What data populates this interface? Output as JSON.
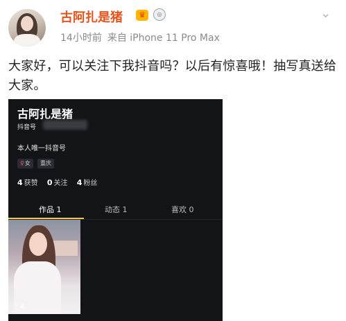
{
  "post": {
    "username": "古阿扎是猪",
    "vip_badge_glyph": "♛",
    "level_badge_glyph": "◎",
    "more_glyph": "⌄",
    "time": "14小时前",
    "source": "来自 iPhone 11 Pro Max",
    "text": "大家好，可以关注下我抖音吗？以后有惊喜哦！抽写真送给大家。"
  },
  "douyin_profile": {
    "name": "古阿扎是猪",
    "id_label": "抖音号",
    "bio": "本人唯一抖音号",
    "gender_icon": "♀",
    "gender_tag": "女",
    "city_tag": "重庆",
    "stats": [
      {
        "value": "4",
        "label": "获赞"
      },
      {
        "value": "0",
        "label": "关注"
      },
      {
        "value": "4",
        "label": "粉丝"
      }
    ],
    "tabs": [
      "作品 1",
      "动态 1",
      "喜欢 0"
    ],
    "video": {
      "like_icon": "♡",
      "likes": "4"
    }
  },
  "colors": {
    "username": "#e5531a",
    "text": "#222222",
    "meta": "#8a8a8a",
    "screenshot_bg": "#131418",
    "tab_active_underline": "#f2c94c"
  },
  "icons": {
    "avatar": "avatar-photo",
    "vip": "crown-icon",
    "level": "level-medal-icon",
    "more": "chevron-down-icon",
    "gender": "female-icon",
    "like": "heart-icon"
  }
}
